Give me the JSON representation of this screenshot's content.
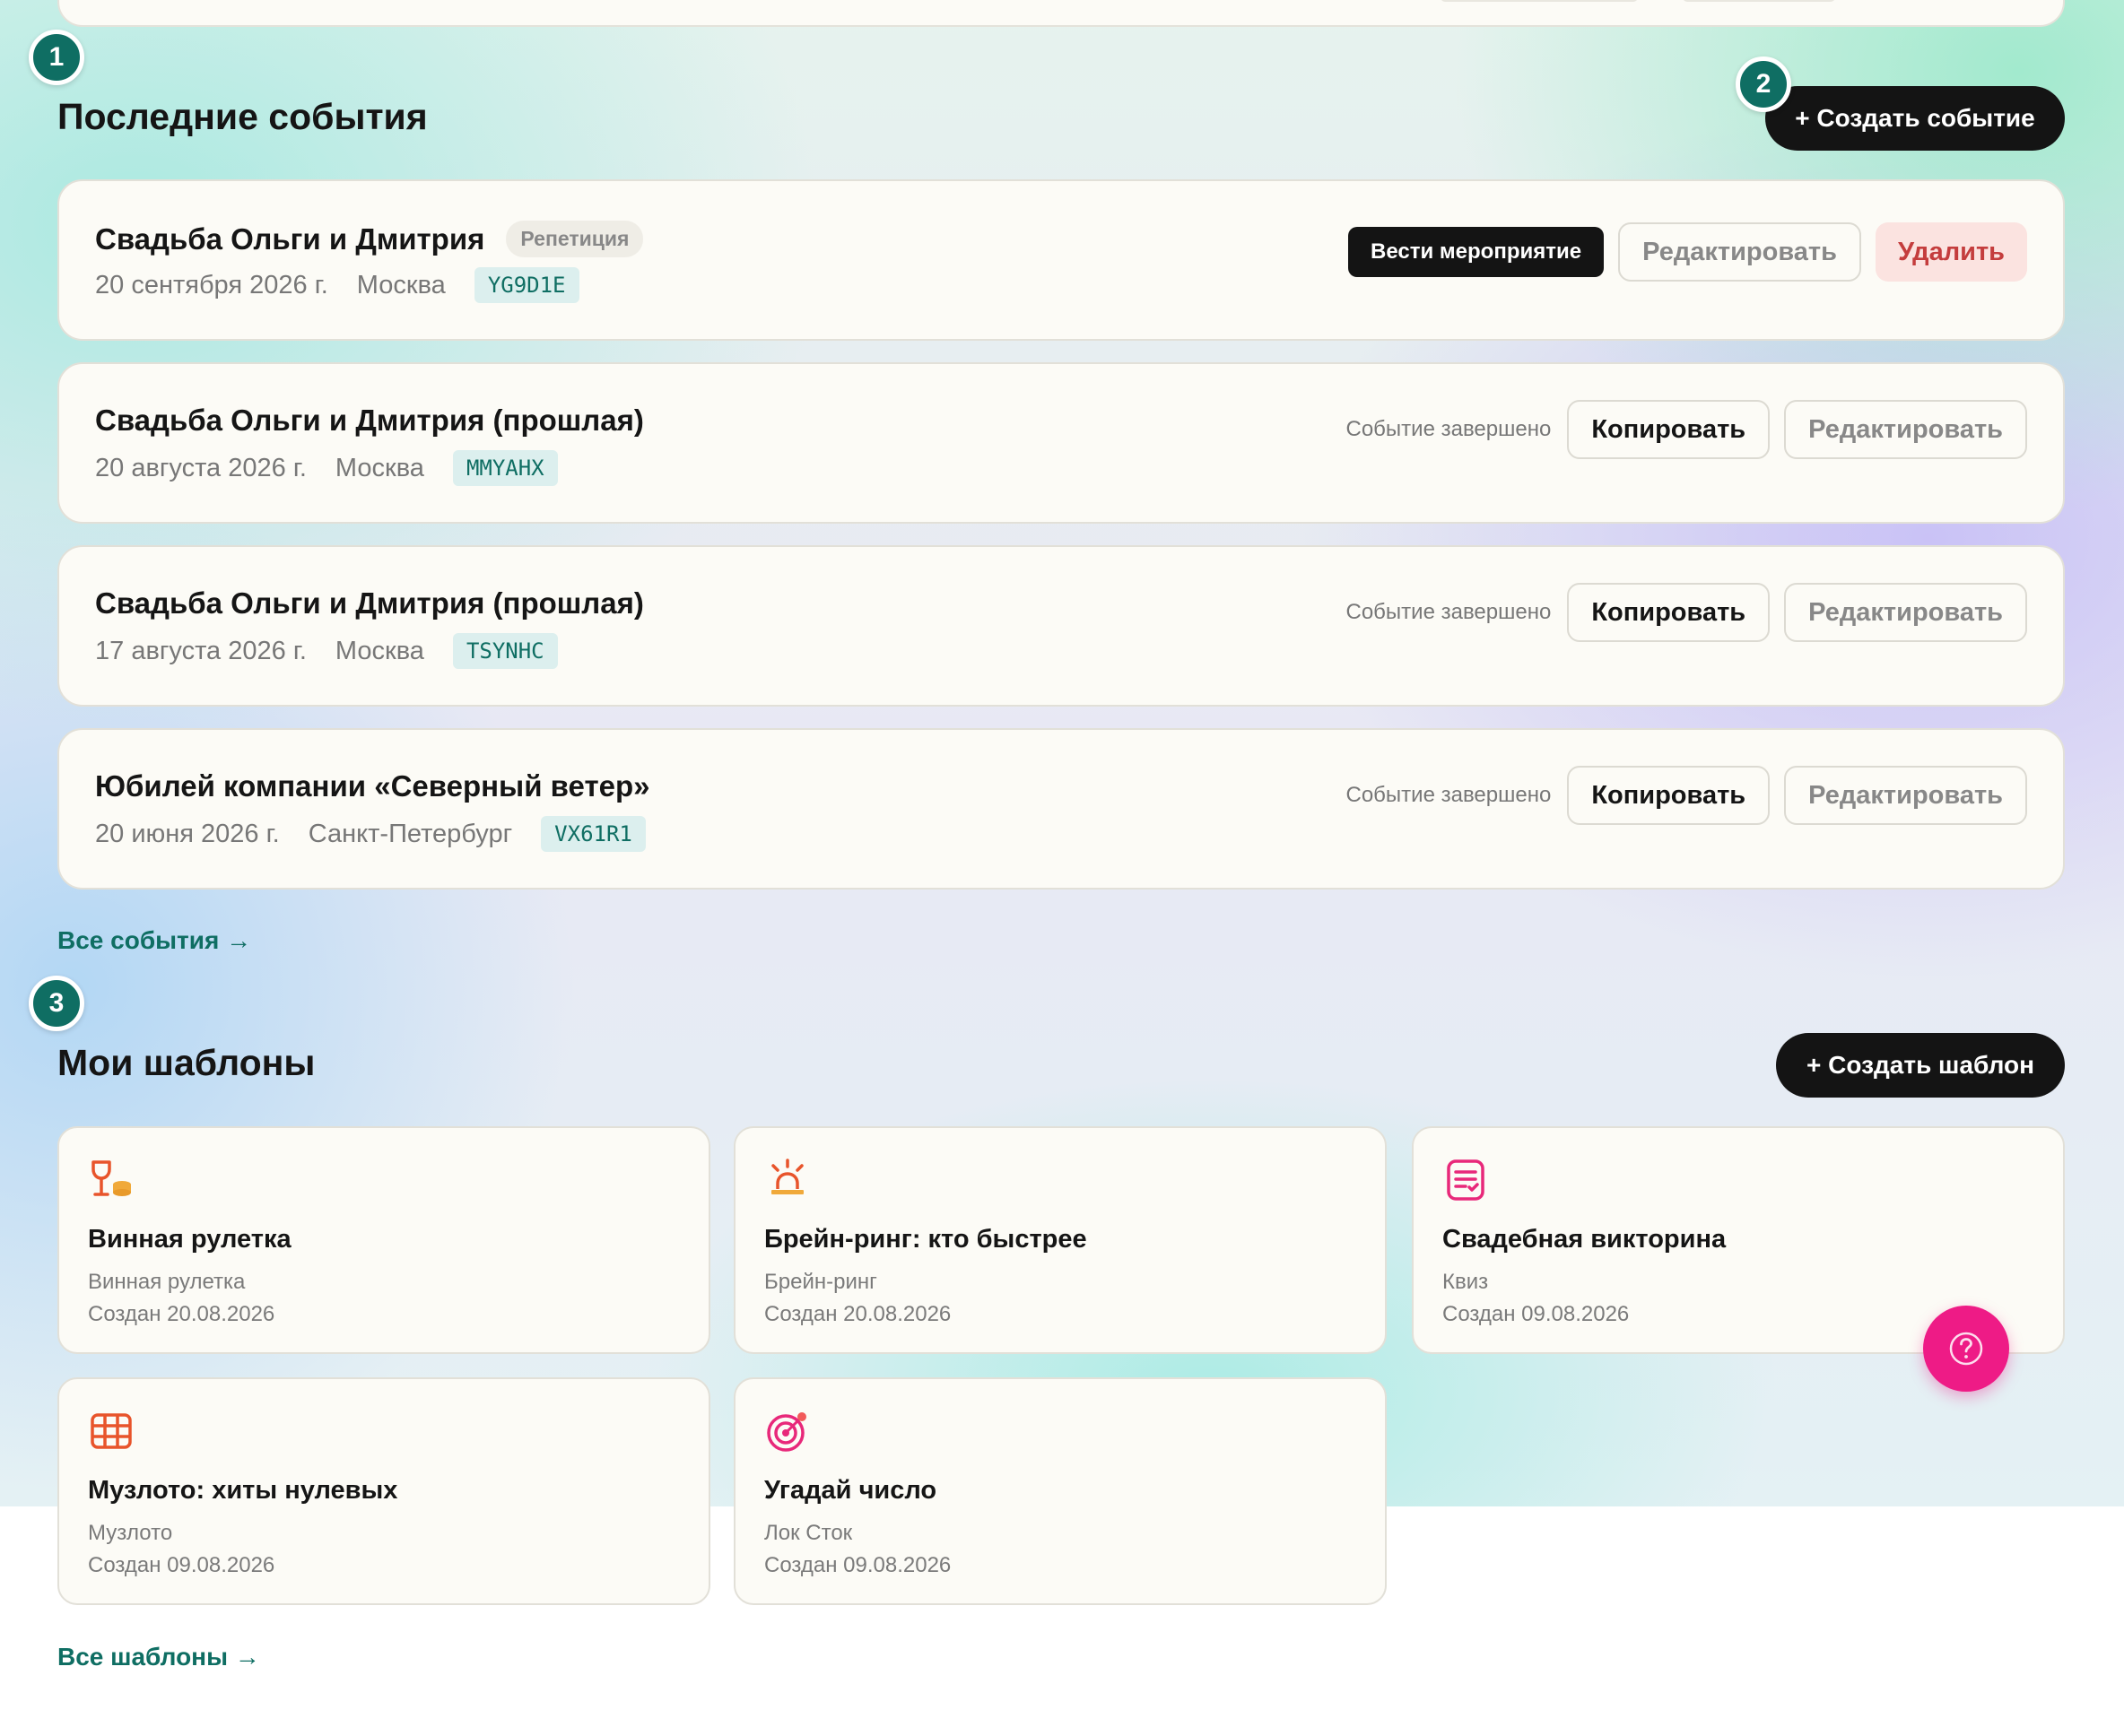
{
  "steps": [
    "1",
    "2",
    "3"
  ],
  "events_section": {
    "title": "Последние события",
    "create_label": "+ Создать событие",
    "all_link": "Все события →"
  },
  "events": [
    {
      "title": "Свадьба Ольги и Дмитрия",
      "tag": "Репетиция",
      "date": "20 сентября 2026 г.",
      "location": "Москва",
      "code": "YG9D1E",
      "run_label": "Вести мероприятие",
      "edit_label": "Редактировать",
      "delete_label": "Удалить"
    },
    {
      "title": "Свадьба Ольги и Дмитрия (прошлая)",
      "date": "20 августа 2026 г.",
      "location": "Москва",
      "code": "MMYAHX",
      "status": "Событие завершено",
      "copy_label": "Копировать",
      "edit_label": "Редактировать"
    },
    {
      "title": "Свадьба Ольги и Дмитрия (прошлая)",
      "date": "17 августа 2026 г.",
      "location": "Москва",
      "code": "TSYNHC",
      "status": "Событие завершено",
      "copy_label": "Копировать",
      "edit_label": "Редактировать"
    },
    {
      "title": "Юбилей компании «Северный ветер»",
      "date": "20 июня 2026 г.",
      "location": "Санкт-Петербург",
      "code": "VX61R1",
      "status": "Событие завершено",
      "copy_label": "Копировать",
      "edit_label": "Редактировать"
    }
  ],
  "templates_section": {
    "title": "Мои шаблоны",
    "create_label": "+ Создать шаблон",
    "all_link": "Все шаблоны →"
  },
  "templates": [
    {
      "name": "Винная рулетка",
      "type": "Винная рулетка",
      "created": "Создан 20.08.2026",
      "icon": "wine-roulette-icon"
    },
    {
      "name": "Брейн-ринг: кто быстрее",
      "type": "Брейн-ринг",
      "created": "Создан 20.08.2026",
      "icon": "buzzer-icon"
    },
    {
      "name": "Свадебная викторина",
      "type": "Квиз",
      "created": "Создан 09.08.2026",
      "icon": "quiz-list-icon"
    },
    {
      "name": "Музлото: хиты нулевых",
      "type": "Музлото",
      "created": "Создан 09.08.2026",
      "icon": "bingo-grid-icon"
    },
    {
      "name": "Угадай число",
      "type": "Лок Сток",
      "created": "Создан 09.08.2026",
      "icon": "target-icon"
    }
  ],
  "colors": {
    "accent": "#0f6e63",
    "dark_button": "#141414",
    "danger": "#c43d3d",
    "help_fab": "#ee1b86"
  },
  "help_icon": "question-circle-icon"
}
